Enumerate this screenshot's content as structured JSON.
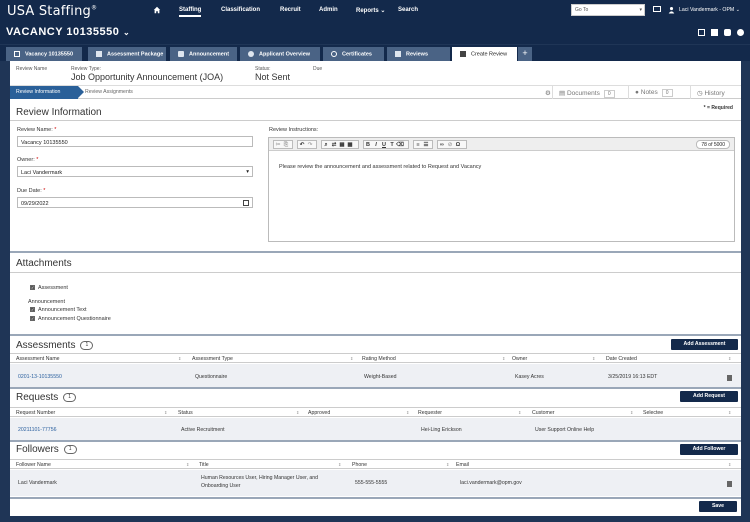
{
  "header": {
    "logo": "USA Staffing",
    "logo_mark": "®",
    "nav": [
      "Staffing",
      "Classification",
      "Recruit",
      "Admin",
      "Reports",
      "Search"
    ],
    "goto_placeholder": "Go To",
    "user": "Laci Vandermark - OPM"
  },
  "vacancy": {
    "title": "VACANCY 10135550"
  },
  "tabs": [
    {
      "label": "Vacancy 10135550"
    },
    {
      "label": "Assessment Package"
    },
    {
      "label": "Announcement"
    },
    {
      "label": "Applicant Overview"
    },
    {
      "label": "Certificates"
    },
    {
      "label": "Reviews"
    },
    {
      "label": "Create Review"
    }
  ],
  "tab_add": "+",
  "info": {
    "review_name_label": "Review Name",
    "review_type_label": "Review Type:",
    "review_type_value": "Job Opportunity Announcement (JOA)",
    "status_label": "Status:",
    "status_value": "Not Sent",
    "due_label": "Due"
  },
  "subtabs": {
    "active": "Review Information",
    "second": "Review Assignments",
    "documents": "Documents",
    "documents_count": "0",
    "notes": "Notes",
    "notes_count": "0",
    "history": "History"
  },
  "review_info": {
    "title": "Review Information",
    "required_note": "* = Required",
    "name_label": "Review Name:",
    "name_value": "Vacancy 10135550",
    "owner_label": "Owner:",
    "owner_value": "Laci Vandermark",
    "due_label": "Due Date:",
    "due_value": "09/29/2022",
    "instructions_label": "Review Instructions:",
    "char_count": "78 of 5000",
    "instructions_text": "Please review the announcement and assessment related to Request and Vacancy"
  },
  "attachments": {
    "title": "Attachments",
    "assessment": "Assessment",
    "announcement_group": "Announcement",
    "announcement_text": "Announcement Text",
    "announcement_questionnaire": "Announcement Questionnaire"
  },
  "assessments": {
    "title": "Assessments",
    "count": "1",
    "button": "Add Assessment",
    "columns": [
      "Assessment Name",
      "Assessment Type",
      "Rating Method",
      "Owner",
      "Date Created"
    ],
    "rows": [
      {
        "name": "0201-13-10135550",
        "type": "Questionnaire",
        "method": "Weight-Based",
        "owner": "Kasey Acres",
        "date": "3/25/2019 16:13 EDT"
      }
    ]
  },
  "requests": {
    "title": "Requests",
    "count": "1",
    "button": "Add Request",
    "columns": [
      "Request Number",
      "Status",
      "Approved",
      "Requester",
      "Customer",
      "Selectee"
    ],
    "rows": [
      {
        "number": "20211101-77756",
        "status": "Active Recruitment",
        "approved": "",
        "requester": "Hei-Ling Erickson",
        "customer": "User Support Online Help",
        "selectee": ""
      }
    ]
  },
  "followers": {
    "title": "Followers",
    "count": "1",
    "button": "Add Follower",
    "columns": [
      "Follower Name",
      "Title",
      "Phone",
      "Email"
    ],
    "rows": [
      {
        "name": "Laci Vandermark",
        "title": "Human Resources User, Hiring Manager User, and Onboarding User",
        "phone": "555-555-5555",
        "email": "laci.vandermark@opm.gov"
      }
    ]
  },
  "save_button": "Save"
}
